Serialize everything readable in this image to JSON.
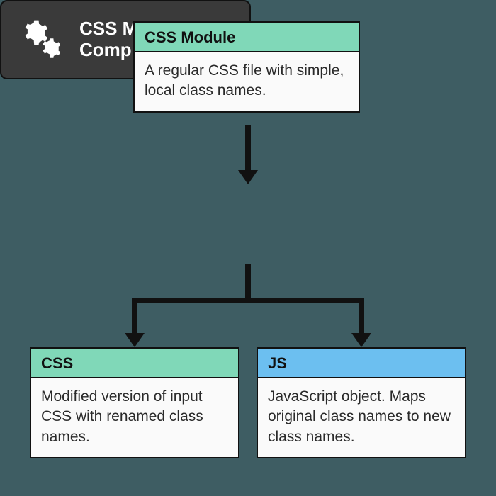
{
  "module": {
    "title": "CSS Module",
    "body": "A regular CSS file with simple, local class names."
  },
  "compiler": {
    "label_line1": "CSS Modules",
    "label_line2": "Compiler"
  },
  "css_out": {
    "title": "CSS",
    "body": "Modified version of input CSS with renamed class names."
  },
  "js_out": {
    "title": "JS",
    "body": "JavaScript object. Maps original class names to new class names."
  },
  "icons": {
    "gear": "gear-icon"
  }
}
